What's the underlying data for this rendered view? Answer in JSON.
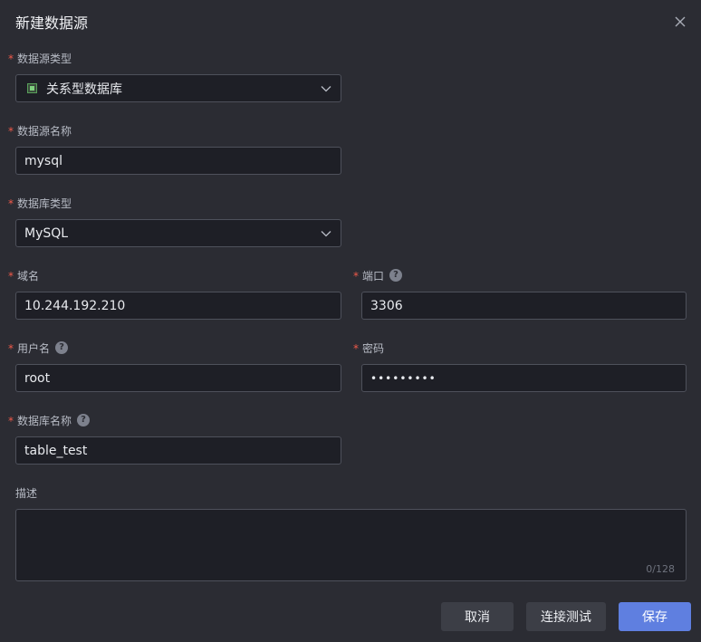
{
  "dialog": {
    "title": "新建数据源"
  },
  "fields": {
    "datasource_type": {
      "label": "数据源类型",
      "value": "关系型数据库",
      "required": true
    },
    "datasource_name": {
      "label": "数据源名称",
      "value": "mysql",
      "required": true
    },
    "database_type": {
      "label": "数据库类型",
      "value": "MySQL",
      "required": true
    },
    "host": {
      "label": "域名",
      "value": "10.244.192.210",
      "required": true
    },
    "port": {
      "label": "端口",
      "value": "3306",
      "required": true
    },
    "username": {
      "label": "用户名",
      "value": "root",
      "required": true
    },
    "password": {
      "label": "密码",
      "value": "•••••••••",
      "required": true
    },
    "database_name": {
      "label": "数据库名称",
      "value": "table_test",
      "required": true
    },
    "description": {
      "label": "描述",
      "value": "",
      "counter": "0/128"
    }
  },
  "required_mark": "*",
  "help_mark": "?",
  "buttons": {
    "cancel": "取消",
    "test_connection": "连接测试",
    "save": "保存"
  },
  "colors": {
    "background": "#2b2c33",
    "field_background": "#1e1f26",
    "border": "#4e515b",
    "required": "#f05a4a",
    "primary": "#5f7fe0"
  }
}
